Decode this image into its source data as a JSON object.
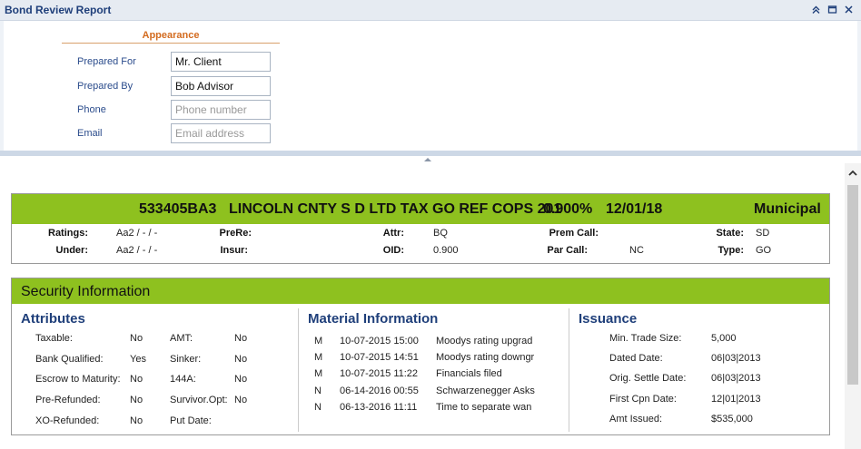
{
  "window": {
    "title": "Bond Review Report",
    "icons": [
      "collapse-up-icon",
      "maximize-icon",
      "close-icon"
    ]
  },
  "appearance": {
    "heading": "Appearance",
    "fields": [
      {
        "label": "Prepared For",
        "value": "Mr. Client",
        "placeholder": ""
      },
      {
        "label": "Prepared By",
        "value": "Bob Advisor",
        "placeholder": ""
      },
      {
        "label": "Phone",
        "value": "",
        "placeholder": "Phone number"
      },
      {
        "label": "Email",
        "value": "",
        "placeholder": "Email address"
      }
    ]
  },
  "bond": {
    "cusip": "533405BA3",
    "description": "LINCOLN CNTY S D LTD TAX GO REF COPS 201",
    "coupon": "0.900%",
    "maturity": "12/01/18",
    "category": "Municipal",
    "ratings_label": "Ratings:",
    "ratings": "Aa2 / - / -",
    "under_label": "Under:",
    "under": "Aa2 / - / -",
    "prere_label": "PreRe:",
    "prere": "",
    "insur_label": "Insur:",
    "insur": "",
    "attr_label": "Attr:",
    "attr": "BQ",
    "oid_label": "OID:",
    "oid": "0.900",
    "premcall_label": "Prem Call:",
    "premcall": "",
    "parcall_label": "Par Call:",
    "parcall": "NC",
    "state_label": "State:",
    "state": "SD",
    "type_label": "Type:",
    "type": "GO"
  },
  "security": {
    "heading": "Security Information",
    "attributes_title": "Attributes",
    "attributes_left": [
      {
        "label": "Taxable:",
        "value": "No"
      },
      {
        "label": "Bank Qualified:",
        "value": "Yes"
      },
      {
        "label": "Escrow to Maturity:",
        "value": "No"
      },
      {
        "label": "Pre-Refunded:",
        "value": "No"
      },
      {
        "label": "XO-Refunded:",
        "value": "No"
      }
    ],
    "attributes_right": [
      {
        "label": "AMT:",
        "value": "No"
      },
      {
        "label": "Sinker:",
        "value": "No"
      },
      {
        "label": "144A:",
        "value": "No"
      },
      {
        "label": "Survivor.Opt:",
        "value": "No"
      },
      {
        "label": "Put Date:",
        "value": ""
      }
    ],
    "material_title": "Material Information",
    "material": [
      {
        "flag": "M",
        "date": "10-07-2015 15:00",
        "text": "Moodys rating upgrad"
      },
      {
        "flag": "M",
        "date": "10-07-2015 14:51",
        "text": "Moodys rating downgr"
      },
      {
        "flag": "M",
        "date": "10-07-2015 11:22",
        "text": "Financials filed"
      },
      {
        "flag": "N",
        "date": "06-14-2016 00:55",
        "text": "Schwarzenegger Asks"
      },
      {
        "flag": "N",
        "date": "06-13-2016 11:11",
        "text": "Time to separate wan"
      }
    ],
    "issuance_title": "Issuance",
    "issuance": [
      {
        "label": "Min. Trade Size:",
        "value": "5,000"
      },
      {
        "label": "Dated Date:",
        "value": "06|03|2013"
      },
      {
        "label": "Orig. Settle Date:",
        "value": "06|03|2013"
      },
      {
        "label": "First Cpn Date:",
        "value": "12|01|2013"
      },
      {
        "label": "Amt Issued:",
        "value": "$535,000"
      }
    ]
  },
  "colors": {
    "accent_green": "#8ec11f",
    "title_blue": "#1f3f7a",
    "appearance_orange": "#d36b1f"
  }
}
